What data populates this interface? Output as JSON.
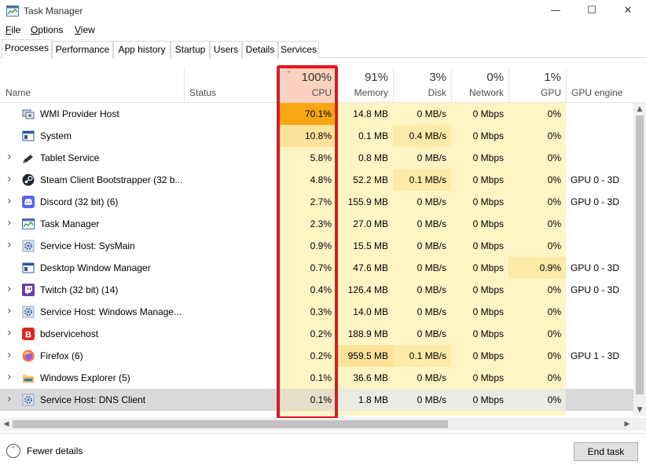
{
  "window": {
    "title": "Task Manager",
    "minimize_glyph": "—",
    "maximize_glyph": "☐",
    "close_glyph": "✕"
  },
  "menu": [
    {
      "label": "File",
      "underline": "F",
      "rest": "ile"
    },
    {
      "label": "Options",
      "underline": "O",
      "rest": "ptions"
    },
    {
      "label": "View",
      "underline": "V",
      "rest": "iew"
    }
  ],
  "tabs": [
    "Processes",
    "Performance",
    "App history",
    "Startup",
    "Users",
    "Details",
    "Services"
  ],
  "active_tab": "Processes",
  "columns": {
    "name": "Name",
    "status": "Status",
    "cpu": {
      "pct": "100%",
      "label": "CPU"
    },
    "memory": {
      "pct": "91%",
      "label": "Memory"
    },
    "disk": {
      "pct": "3%",
      "label": "Disk"
    },
    "network": {
      "pct": "0%",
      "label": "Network"
    },
    "gpu": {
      "pct": "1%",
      "label": "GPU"
    },
    "gpu_engine": "GPU engine",
    "sort_glyph": "˅"
  },
  "processes": [
    {
      "name": "WMI Provider Host",
      "icon": "wmi-icon",
      "expand": false,
      "status": "",
      "cpu": "70.1%",
      "memory": "14.8 MB",
      "disk": "0 MB/s",
      "network": "0 Mbps",
      "gpu": "0%",
      "gpu_engine": ""
    },
    {
      "name": "System",
      "icon": "system-icon",
      "expand": false,
      "status": "",
      "cpu": "10.8%",
      "memory": "0.1 MB",
      "disk": "0.4 MB/s",
      "network": "0 Mbps",
      "gpu": "0%",
      "gpu_engine": ""
    },
    {
      "name": "Tablet Service",
      "icon": "pen-icon",
      "expand": true,
      "status": "",
      "cpu": "5.8%",
      "memory": "0.8 MB",
      "disk": "0 MB/s",
      "network": "0 Mbps",
      "gpu": "0%",
      "gpu_engine": ""
    },
    {
      "name": "Steam Client Bootstrapper (32 b...",
      "icon": "steam-icon",
      "expand": true,
      "status": "",
      "cpu": "4.8%",
      "memory": "52.2 MB",
      "disk": "0.1 MB/s",
      "network": "0 Mbps",
      "gpu": "0%",
      "gpu_engine": "GPU 0 - 3D"
    },
    {
      "name": "Discord (32 bit) (6)",
      "icon": "discord-icon",
      "expand": true,
      "status": "",
      "cpu": "2.7%",
      "memory": "155.9 MB",
      "disk": "0 MB/s",
      "network": "0 Mbps",
      "gpu": "0%",
      "gpu_engine": "GPU 0 - 3D"
    },
    {
      "name": "Task Manager",
      "icon": "task-manager-icon",
      "expand": true,
      "status": "",
      "cpu": "2.3%",
      "memory": "27.0 MB",
      "disk": "0 MB/s",
      "network": "0 Mbps",
      "gpu": "0%",
      "gpu_engine": ""
    },
    {
      "name": "Service Host: SysMain",
      "icon": "gear-icon",
      "expand": true,
      "status": "",
      "cpu": "0.9%",
      "memory": "15.5 MB",
      "disk": "0 MB/s",
      "network": "0 Mbps",
      "gpu": "0%",
      "gpu_engine": ""
    },
    {
      "name": "Desktop Window Manager",
      "icon": "dwm-icon",
      "expand": false,
      "status": "",
      "cpu": "0.7%",
      "memory": "47.6 MB",
      "disk": "0 MB/s",
      "network": "0 Mbps",
      "gpu": "0.9%",
      "gpu_engine": "GPU 0 - 3D"
    },
    {
      "name": "Twitch (32 bit) (14)",
      "icon": "twitch-icon",
      "expand": true,
      "status": "",
      "cpu": "0.4%",
      "memory": "126.4 MB",
      "disk": "0 MB/s",
      "network": "0 Mbps",
      "gpu": "0%",
      "gpu_engine": "GPU 0 - 3D"
    },
    {
      "name": "Service Host: Windows Manage...",
      "icon": "gear-icon",
      "expand": true,
      "status": "",
      "cpu": "0.3%",
      "memory": "14.0 MB",
      "disk": "0 MB/s",
      "network": "0 Mbps",
      "gpu": "0%",
      "gpu_engine": ""
    },
    {
      "name": "bdservicehost",
      "icon": "bitdefender-icon",
      "expand": true,
      "status": "",
      "cpu": "0.2%",
      "memory": "188.9 MB",
      "disk": "0 MB/s",
      "network": "0 Mbps",
      "gpu": "0%",
      "gpu_engine": ""
    },
    {
      "name": "Firefox (6)",
      "icon": "firefox-icon",
      "expand": true,
      "status": "",
      "cpu": "0.2%",
      "memory": "959.5 MB",
      "disk": "0.1 MB/s",
      "network": "0 Mbps",
      "gpu": "0%",
      "gpu_engine": "GPU 1 - 3D"
    },
    {
      "name": "Windows Explorer (5)",
      "icon": "folder-icon",
      "expand": true,
      "status": "",
      "cpu": "0.1%",
      "memory": "36.6 MB",
      "disk": "0 MB/s",
      "network": "0 Mbps",
      "gpu": "0%",
      "gpu_engine": ""
    },
    {
      "name": "Service Host: DNS Client",
      "icon": "gear-icon",
      "expand": true,
      "status": "",
      "cpu": "0.1%",
      "memory": "1.8 MB",
      "disk": "0 MB/s",
      "network": "0 Mbps",
      "gpu": "0%",
      "gpu_engine": ""
    }
  ],
  "selected_row": 13,
  "footer": {
    "fewer_details": "Fewer details",
    "end_task": "End task"
  },
  "colors": {
    "cpu_heavy": "#f7a614",
    "cpu_high": "#fde29a",
    "cell_light": "#fff4c4",
    "mem_high": "#fde29a",
    "highlight": "#e8121e",
    "selected": "#d9d9d9"
  }
}
